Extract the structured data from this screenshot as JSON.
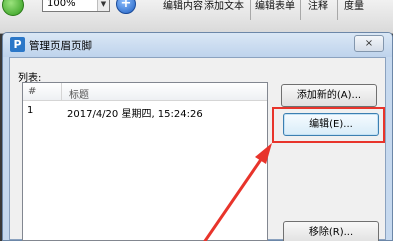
{
  "toolbar": {
    "zoom_value": "100%",
    "items": [
      "编辑内容",
      "添加文本",
      "编辑表单",
      "注释",
      "度量"
    ]
  },
  "dialog": {
    "title": "管理页眉页脚",
    "app_icon_letter": "P",
    "close_label": "×"
  },
  "list": {
    "caption": "列表:",
    "columns": [
      "#",
      "标题"
    ],
    "rows": [
      {
        "num": "1",
        "title": "2017/4/20 星期四, 15:24:26"
      }
    ]
  },
  "buttons": {
    "add": "添加新的(A)...",
    "edit": "编辑(E)...",
    "remove": "移除(R)..."
  },
  "colors": {
    "annotation": "#e8342b",
    "dialog_frame": "#c6d9ef",
    "focus_border": "#3c7fb1"
  }
}
